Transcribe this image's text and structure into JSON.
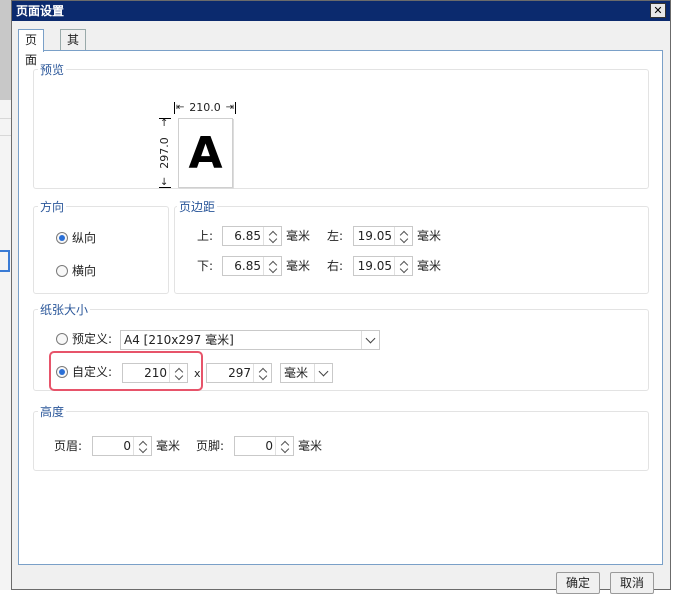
{
  "dialog": {
    "title": "页面设置",
    "close": "✕"
  },
  "tabs": [
    "页面",
    "其他"
  ],
  "preview": {
    "title": "预览",
    "width_label": "210.0",
    "height_label": "297.0",
    "letter": "A"
  },
  "orientation": {
    "title": "方向",
    "portrait": "纵向",
    "landscape": "横向"
  },
  "margins": {
    "title": "页边距",
    "top_label": "上:",
    "top_value": "6.85",
    "bottom_label": "下:",
    "bottom_value": "6.85",
    "left_label": "左:",
    "left_value": "19.05",
    "right_label": "右:",
    "right_value": "19.05",
    "unit": "毫米"
  },
  "paper_size": {
    "title": "纸张大小",
    "predefined_label": "预定义:",
    "predefined_value": "A4 [210x297 毫米]",
    "custom_label": "自定义:",
    "width_value": "210",
    "times": "x",
    "height_value": "297",
    "unit_value": "毫米"
  },
  "height": {
    "title": "高度",
    "header_label": "页眉:",
    "header_value": "0",
    "footer_label": "页脚:",
    "footer_value": "0",
    "unit": "毫米"
  },
  "buttons": {
    "ok": "确定",
    "cancel": "取消"
  }
}
